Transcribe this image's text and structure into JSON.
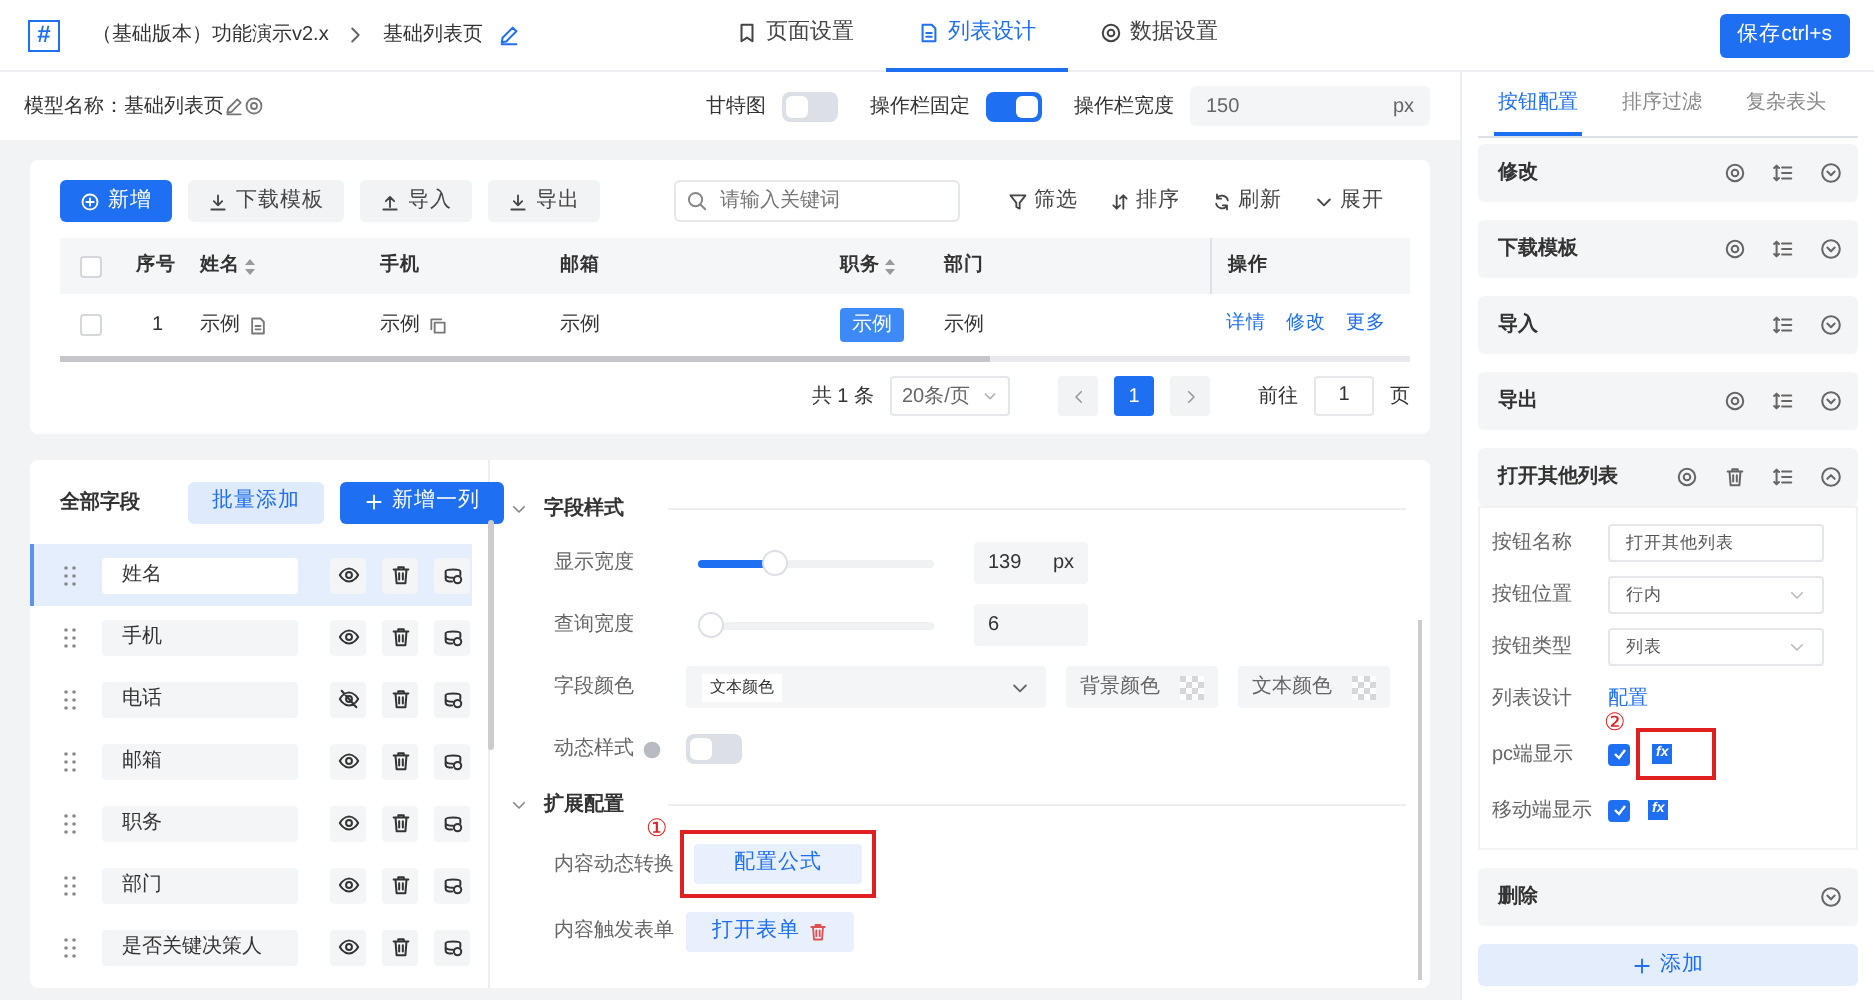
{
  "header": {
    "logo": "#",
    "breadcrumb": [
      "（基础版本）功能演示v2.x",
      "基础列表页"
    ],
    "tabs": [
      {
        "label": "页面设置",
        "selected": false
      },
      {
        "label": "列表设计",
        "selected": true
      },
      {
        "label": "数据设置",
        "selected": false
      }
    ],
    "save_button": "保存ctrl+s"
  },
  "model_bar": {
    "model_label": "模型名称：基础列表页",
    "toggles": [
      {
        "label": "甘特图",
        "on": false
      },
      {
        "label": "操作栏固定",
        "on": true
      }
    ],
    "width_label": "操作栏宽度",
    "width_value": "150",
    "width_unit": "px"
  },
  "preview": {
    "buttons": [
      {
        "label": "新增",
        "kind": "add"
      },
      {
        "label": "下载模板",
        "kind": "download"
      },
      {
        "label": "导入",
        "kind": "upload"
      },
      {
        "label": "导出",
        "kind": "download"
      }
    ],
    "search_placeholder": "请输入关键词",
    "tools": [
      "筛选",
      "排序",
      "刷新",
      "展开"
    ],
    "table": {
      "header_checked": false,
      "columns": [
        {
          "label": "序号",
          "sortable": false
        },
        {
          "label": "姓名",
          "sortable": true
        },
        {
          "label": "手机",
          "sortable": false
        },
        {
          "label": "邮箱",
          "sortable": false
        },
        {
          "label": "职务",
          "sortable": true
        },
        {
          "label": "部门",
          "sortable": false
        },
        {
          "label": "操作",
          "sortable": false
        }
      ],
      "rows": [
        {
          "checked": false,
          "cells": [
            {
              "kind": "text",
              "text": "1"
            },
            {
              "kind": "note",
              "text": "示例"
            },
            {
              "kind": "copy",
              "text": "示例"
            },
            {
              "kind": "text",
              "text": "示例"
            },
            {
              "kind": "tag",
              "text": "示例"
            },
            {
              "kind": "text",
              "text": "示例"
            },
            {
              "kind": "actions",
              "links": [
                "详情",
                "修改",
                "更多"
              ]
            }
          ]
        }
      ]
    },
    "pagination": {
      "total": "共 1 条",
      "page_size": "20条/页",
      "pages": [
        {
          "label": "1",
          "selected": true
        }
      ],
      "goto_label": "前往",
      "goto_value": "1",
      "goto_unit": "页"
    }
  },
  "fields": {
    "title": "全部字段",
    "batch_button": "批量添加",
    "add_button": "新增一列",
    "items": [
      {
        "name": "姓名",
        "visible": true,
        "selected": true
      },
      {
        "name": "手机",
        "visible": true,
        "selected": false
      },
      {
        "name": "电话",
        "visible": false,
        "selected": false
      },
      {
        "name": "邮箱",
        "visible": true,
        "selected": false
      },
      {
        "name": "职务",
        "visible": true,
        "selected": false
      },
      {
        "name": "部门",
        "visible": true,
        "selected": false
      },
      {
        "name": "是否关键决策人",
        "visible": true,
        "selected": false
      }
    ]
  },
  "config": {
    "sections": [
      {
        "title": "字段样式",
        "rows": [
          {
            "kind": "slider",
            "label": "显示宽度",
            "level": 0.3,
            "value": "139",
            "unit": "px"
          },
          {
            "kind": "slider",
            "label": "查询宽度",
            "level": 0,
            "value": "6"
          },
          {
            "kind": "colors",
            "label": "字段颜色",
            "select_tag": "文本颜色",
            "swatches": [
              "背景颜色",
              "文本颜色"
            ]
          },
          {
            "kind": "toggle",
            "label": "动态样式",
            "on": false
          }
        ]
      },
      {
        "title": "扩展配置",
        "rows": [
          {
            "kind": "formula",
            "label": "内容动态转换",
            "button": "配置公式",
            "annotation": "①"
          },
          {
            "kind": "form",
            "label": "内容触发表单",
            "button": "打开表单"
          }
        ]
      }
    ]
  },
  "right_panel": {
    "tabs": [
      {
        "label": "按钮配置",
        "selected": true
      },
      {
        "label": "排序过滤",
        "selected": false
      },
      {
        "label": "复杂表头",
        "selected": false
      }
    ],
    "items": [
      {
        "title": "修改",
        "configurable": true,
        "sortable": true,
        "deletable": false,
        "expanded": false
      },
      {
        "title": "下载模板",
        "configurable": true,
        "sortable": true,
        "deletable": false,
        "expanded": false
      },
      {
        "title": "导入",
        "configurable": false,
        "sortable": true,
        "deletable": false,
        "expanded": false
      },
      {
        "title": "导出",
        "configurable": true,
        "sortable": true,
        "deletable": false,
        "expanded": false
      },
      {
        "title": "打开其他列表",
        "configurable": true,
        "sortable": true,
        "deletable": true,
        "expanded": true,
        "form": [
          {
            "kind": "input",
            "label": "按钮名称",
            "value": "打开其他列表"
          },
          {
            "kind": "select",
            "label": "按钮位置",
            "value": "行内"
          },
          {
            "kind": "select",
            "label": "按钮类型",
            "value": "列表"
          },
          {
            "kind": "link",
            "label": "列表设计",
            "value": "配置"
          },
          {
            "kind": "check",
            "label": "pc端显示",
            "checked": true,
            "formula": "fx",
            "annotation": "②"
          },
          {
            "kind": "check",
            "label": "移动端显示",
            "checked": true,
            "formula": "fx"
          }
        ]
      },
      {
        "title": "删除",
        "configurable": false,
        "sortable": false,
        "deletable": false,
        "expanded": false
      }
    ],
    "add_button": "添加"
  }
}
